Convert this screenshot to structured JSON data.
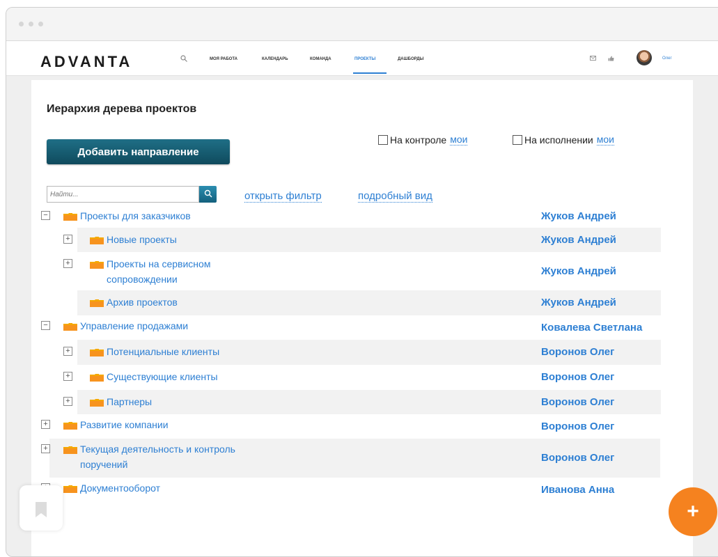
{
  "app": {
    "logo_text": "ADVANTA",
    "accent_color": "#2d7fd3",
    "brand_color": "#f5821f",
    "nav": [
      {
        "label": "Моя работа",
        "active": false
      },
      {
        "label": "Календарь",
        "active": false
      },
      {
        "label": "Команда",
        "active": false
      },
      {
        "label": "Проекты",
        "active": true
      },
      {
        "label": "Дашборды",
        "active": false
      }
    ],
    "user_name": "Олег"
  },
  "page": {
    "title": "Иерархия дерева проектов",
    "add_button": "Добавить направление",
    "filters": {
      "control_label": "На контроле",
      "control_mine": "мои",
      "execution_label": "На исполнении",
      "execution_mine": "мои"
    },
    "search_placeholder": "Найти...",
    "open_filter": "открыть фильтр",
    "detailed_view": "подробный вид"
  },
  "tree": [
    {
      "label": "Проекты для заказчиков",
      "owner": "Жуков Андрей",
      "level": 0,
      "toggle": "minus"
    },
    {
      "label": "Новые проекты",
      "owner": "Жуков Андрей",
      "level": 1,
      "toggle": "plus"
    },
    {
      "label": "Проекты на сервисном сопровождении",
      "owner": "Жуков Андрей",
      "level": 1,
      "toggle": "plus"
    },
    {
      "label": "Архив проектов",
      "owner": "Жуков Андрей",
      "level": 1,
      "toggle": "none"
    },
    {
      "label": "Управление продажами",
      "owner": "Ковалева Светлана",
      "level": 0,
      "toggle": "minus"
    },
    {
      "label": "Потенциальные клиенты",
      "owner": "Воронов Олег",
      "level": 1,
      "toggle": "plus"
    },
    {
      "label": "Существующие клиенты",
      "owner": "Воронов Олег",
      "level": 1,
      "toggle": "plus"
    },
    {
      "label": "Партнеры",
      "owner": "Воронов Олег",
      "level": 1,
      "toggle": "plus"
    },
    {
      "label": "Развитие компании",
      "owner": "Воронов Олег",
      "level": 0,
      "toggle": "plus"
    },
    {
      "label": "Текущая деятельность и контроль поручений",
      "owner": "Воронов Олег",
      "level": 0,
      "toggle": "plus"
    },
    {
      "label": "Документооборот",
      "owner": "Иванова Анна",
      "level": 0,
      "toggle": "plus"
    }
  ],
  "icons": {
    "search": "search-icon",
    "mail": "mail-icon",
    "like": "thumbs-up-icon",
    "folder": "folder-icon",
    "bookmark": "bookmark-icon",
    "add": "plus-icon"
  },
  "fab_label": "+"
}
